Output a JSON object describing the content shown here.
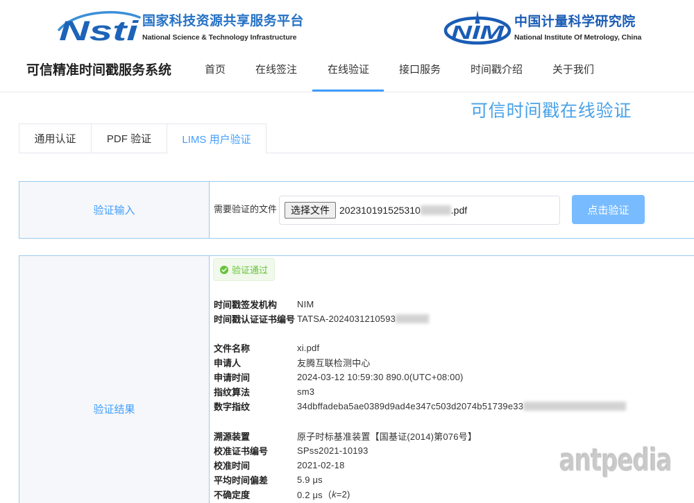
{
  "header": {
    "nsti": {
      "logo_text": "Nsti",
      "title_cn": "国家科技资源共享服务平台",
      "title_en": "National Science & Technology Infrastructure"
    },
    "nim": {
      "logo_text": "NIM",
      "title_cn": "中国计量科学研究院",
      "title_en": "National Institute Of Metrology, China"
    }
  },
  "nav": {
    "site_title": "可信精准时间戳服务系统",
    "items": [
      {
        "label": "首页",
        "active": false
      },
      {
        "label": "在线签注",
        "active": false
      },
      {
        "label": "在线验证",
        "active": true
      },
      {
        "label": "接口服务",
        "active": false
      },
      {
        "label": "时间戳介绍",
        "active": false
      },
      {
        "label": "关于我们",
        "active": false
      }
    ]
  },
  "page_title": "可信时间戳在线验证",
  "tabs": [
    {
      "label": "通用认证",
      "active": false
    },
    {
      "label": "PDF 验证",
      "active": false
    },
    {
      "label": "LIMS 用户验证",
      "active": true
    }
  ],
  "verify_input": {
    "section_label": "验证输入",
    "file_label": "需要验证的文件",
    "choose_file_button": "选择文件",
    "file_name_start": "202310191525310",
    "file_name_end": ".pdf",
    "submit_button": "点击验证"
  },
  "verify_result": {
    "section_label": "验证结果",
    "status": "验证通过",
    "status_icon": "check-circle-icon",
    "groups": [
      [
        {
          "label": "时间戳签发机构",
          "value": "NIM"
        },
        {
          "label": "时间戳认证证书编号",
          "value": "TATSA-2024031210593"
        }
      ],
      [
        {
          "label": "文件名称",
          "value": "xi.pdf"
        },
        {
          "label": "申请人",
          "value": "友腾互联检测中心"
        },
        {
          "label": "申请时间",
          "value": "2024-03-12 10:59:30 890.0(UTC+08:00)"
        },
        {
          "label": "指纹算法",
          "value": "sm3"
        },
        {
          "label": "数字指纹",
          "value": "34dbffadeba5ae0389d9ad4e347c503d2074b51739e33"
        }
      ],
      [
        {
          "label": "溯源装置",
          "value": "原子时标基准装置【国基证(2014)第076号】"
        },
        {
          "label": "校准证书编号",
          "value": "SPss2021-10193"
        },
        {
          "label": "校准时间",
          "value": "2021-02-18"
        },
        {
          "label": "平均时间偏差",
          "value": "5.9 μs"
        },
        {
          "label": "不确定度",
          "value_parts": [
            "0.2 μs（",
            "k",
            "=2)"
          ]
        }
      ]
    ]
  },
  "watermark": "antpedia",
  "colors": {
    "primary_blue": "#409eff",
    "nsti_blue": "#2471c5",
    "nim_blue": "#1a5cb5",
    "page_title_blue": "#4aa2e8",
    "panel_border": "#9ccbf0",
    "submit_button_bg": "#79bbff",
    "success_green": "#67c23a",
    "success_bg": "#f0f9eb"
  }
}
